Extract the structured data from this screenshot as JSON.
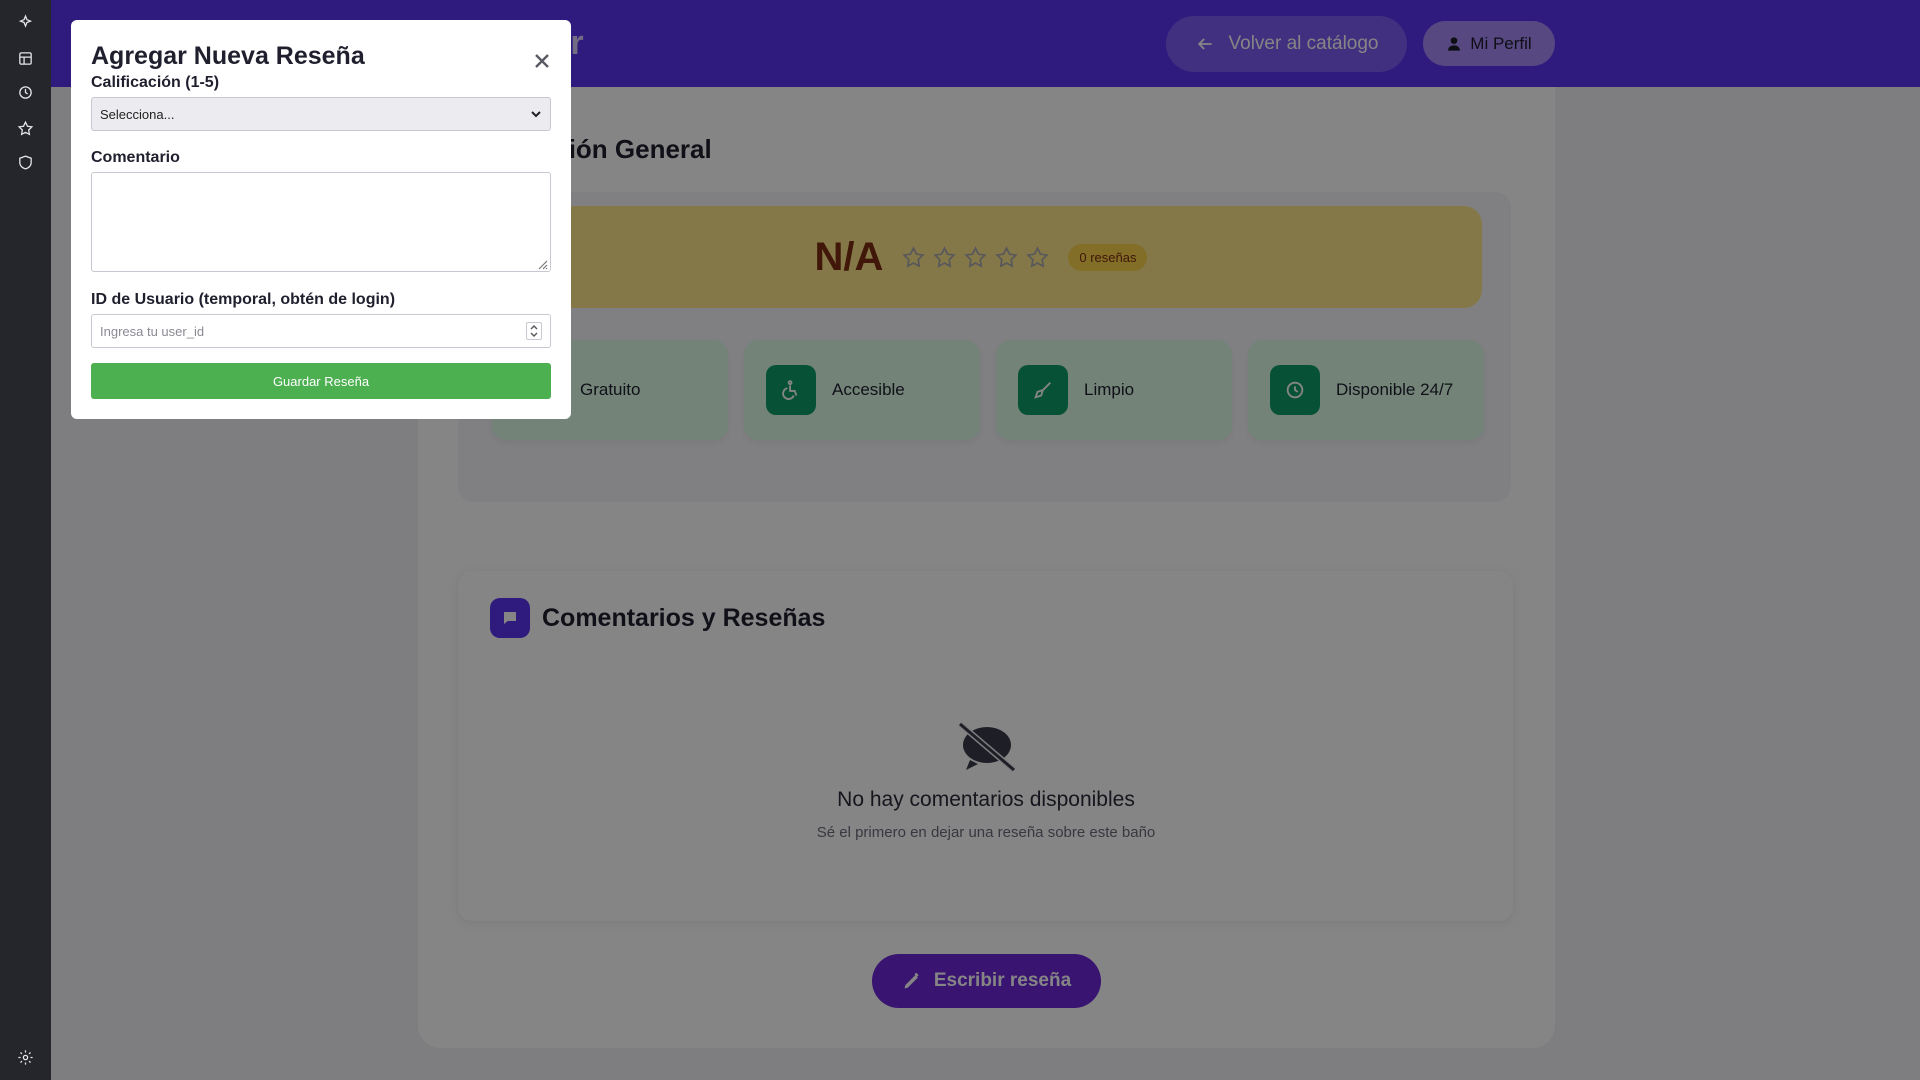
{
  "rail": {
    "icons": [
      "sparkle-icon",
      "bookmark-icon",
      "history-icon",
      "star-icon",
      "shield-icon",
      "gear-icon"
    ]
  },
  "header": {
    "logo_fragment": "er",
    "back_label": "Volver al catálogo",
    "profile_label": "Mi Perfil"
  },
  "info": {
    "section_title": "formación General",
    "rating_value": "N/A",
    "star_count": 5,
    "reviews_badge": "0 reseñas",
    "features": [
      {
        "label": "Gratuito",
        "icon": "free-icon"
      },
      {
        "label": "Accesible",
        "icon": "wheelchair-icon"
      },
      {
        "label": "Limpio",
        "icon": "broom-icon"
      },
      {
        "label": "Disponible 24/7",
        "icon": "clock-icon"
      }
    ]
  },
  "comments": {
    "title": "Comentarios y Reseñas",
    "empty_title": "No hay comentarios disponibles",
    "empty_subtitle": "Sé el primero en dejar una reseña sobre este baño"
  },
  "write_review_label": "Escribir reseña",
  "modal": {
    "title": "Agregar Nueva Reseña",
    "rating_label": "Calificación (1-5)",
    "rating_selected": "Selecciona...",
    "comment_label": "Comentario",
    "comment_value": "",
    "user_id_label": "ID de Usuario (temporal, obtén de login)",
    "user_id_placeholder": "Ingresa tu user_id",
    "save_label": "Guardar Reseña"
  },
  "colors": {
    "header": "#5b35f2",
    "save_button": "#4caf50",
    "feature_icon": "#0f9d68",
    "rating_box": "#fde68a"
  }
}
